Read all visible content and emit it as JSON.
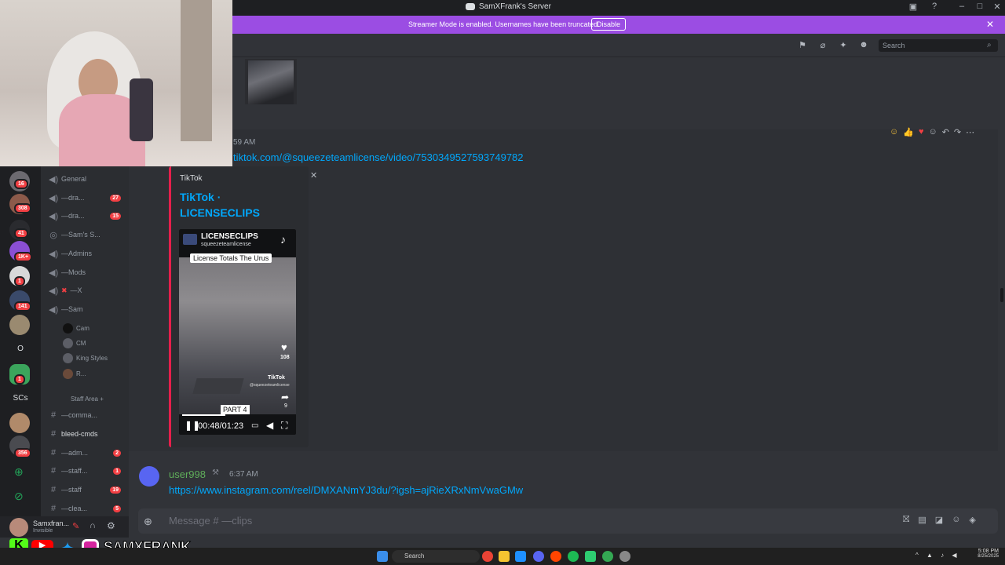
{
  "window": {
    "title": "SamXFrank's Server"
  },
  "banner": {
    "message": "Streamer Mode is enabled. Usernames have been truncated.",
    "disable_label": "Disable"
  },
  "header": {
    "search_placeholder": "Search"
  },
  "servers": {
    "badges": [
      "16",
      "308",
      "41",
      "1K+",
      "1",
      "141",
      "1",
      "356"
    ],
    "text_items": [
      "O",
      "SCs"
    ]
  },
  "channels": {
    "items": [
      {
        "label": "General",
        "badge": ""
      },
      {
        "label": "—dra...",
        "badge": "27"
      },
      {
        "label": "—dra...",
        "badge": "15"
      },
      {
        "label": "—Sam's S...",
        "badge": ""
      },
      {
        "label": "—Admins",
        "badge": ""
      },
      {
        "label": "—Mods",
        "badge": ""
      },
      {
        "label": "—X",
        "badge": ""
      },
      {
        "label": "—Sam",
        "badge": ""
      }
    ],
    "voice_users": [
      "Cam",
      "CM",
      "King Styles",
      "R..."
    ],
    "category": "Staff Area",
    "text_channels": [
      {
        "label": "—comma...",
        "badge": ""
      },
      {
        "label": "bleed-cmds",
        "badge": ""
      },
      {
        "label": "—adm...",
        "badge": "2"
      },
      {
        "label": "—staff...",
        "badge": "1"
      },
      {
        "label": "—staff",
        "badge": "19"
      },
      {
        "label": "—clea...",
        "badge": "5"
      }
    ]
  },
  "user_panel": {
    "name": "Samxfran...",
    "status": "Invisible"
  },
  "messages": [
    {
      "time": "59 AM",
      "link": "tiktok.com/@squeezeteamlicense/video/7530349527593749782",
      "embed": {
        "provider": "TikTok",
        "title_line1": "TikTok ·",
        "title_line2": "LICENSECLIPS",
        "video": {
          "channel": "LICENSECLIPS",
          "handle": "squeezeteamlicense",
          "caption": "License Totals The Urus",
          "likes": "108",
          "part": "PART 4",
          "time": "00:48/01:23",
          "watermark": "TikTok",
          "watermark_handle": "@squeezeteamlicense",
          "shares": "9"
        }
      }
    },
    {
      "author": "user998",
      "time": "6:37 AM",
      "link": "https://www.instagram.com/reel/DMXANmYJ3du/?igsh=ajRieXRxNmVwaGMw"
    }
  ],
  "chat_input": {
    "placeholder": "Message # —clips"
  },
  "overlay": {
    "handle": "SAMXFRANK"
  },
  "taskbar": {
    "search": "Search",
    "time": "5:08 PM",
    "date": "8/25/2025"
  },
  "colors": {
    "accent": "#9b4de3",
    "link": "#00a8fc",
    "badge": "#f23f43"
  }
}
